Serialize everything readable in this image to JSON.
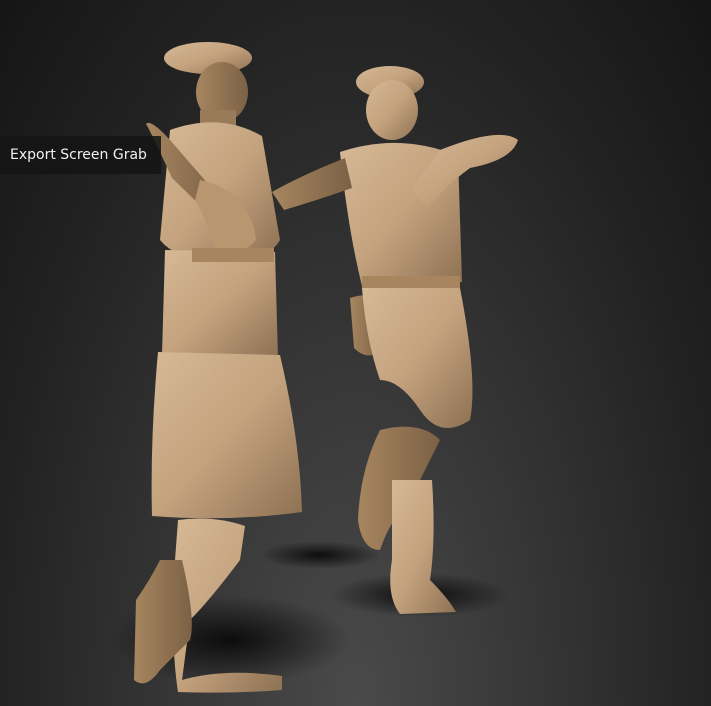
{
  "canvas": {
    "background_color": "#2b2b2b",
    "material_color": "#c4a27e",
    "subject": "sculpted-figures-dancing"
  },
  "tooltip": {
    "label": "Export Screen Grab"
  }
}
